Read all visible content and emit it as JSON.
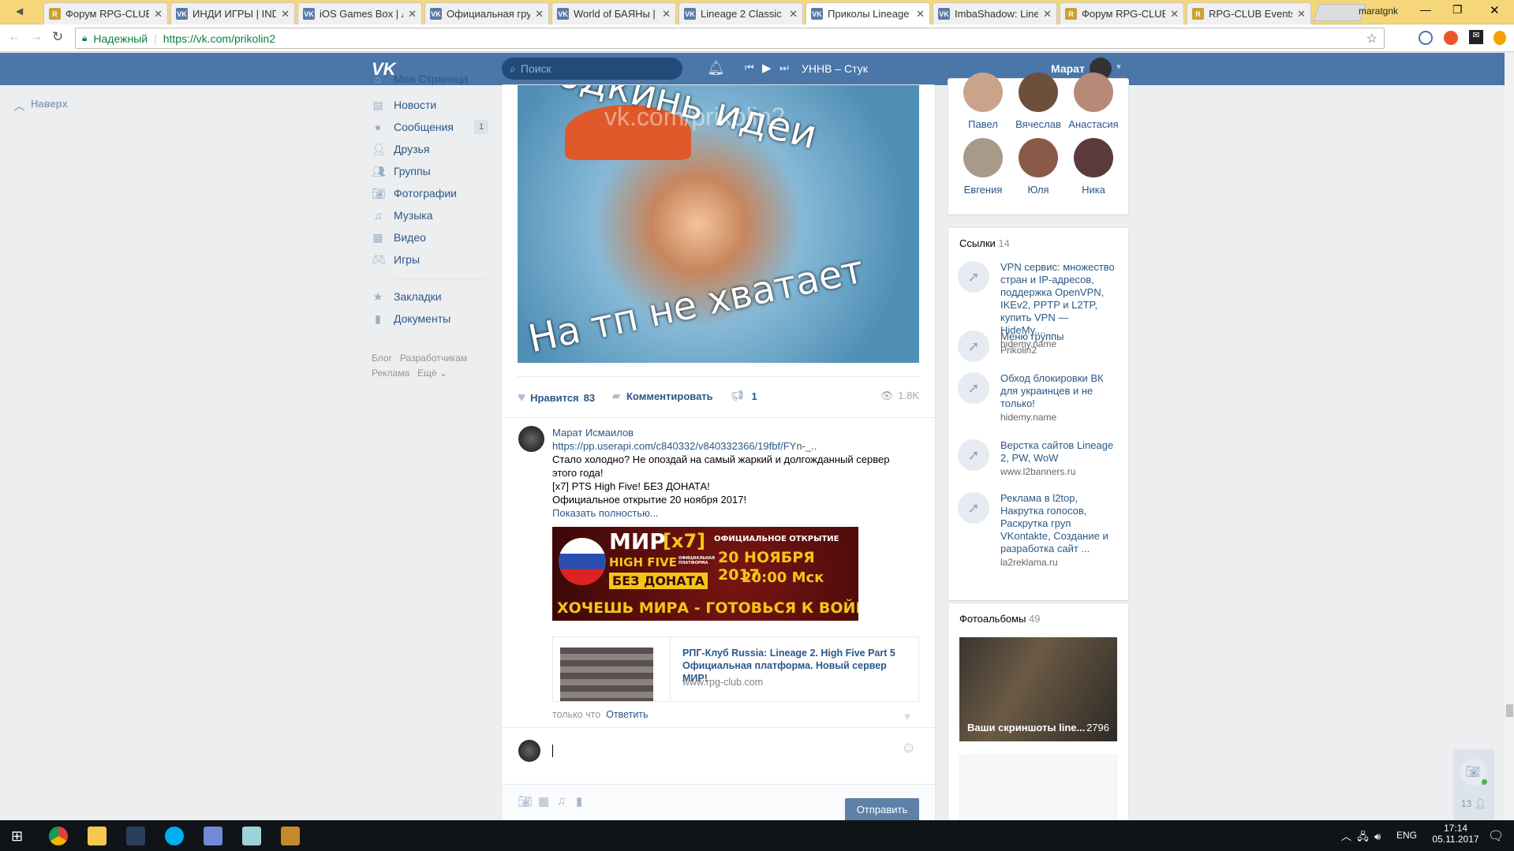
{
  "browser": {
    "tabs": [
      {
        "title": "Форум RPG-CLUB",
        "icon": "rpg"
      },
      {
        "title": "ИНДИ ИГРЫ | IND",
        "icon": "vk"
      },
      {
        "title": "iOS Games Box | Л",
        "icon": "vk"
      },
      {
        "title": "Официальная гру",
        "icon": "vk"
      },
      {
        "title": "World of БАЯНы |",
        "icon": "vk"
      },
      {
        "title": "Lineage 2 Classic",
        "icon": "vk"
      },
      {
        "title": "Приколы Lineage",
        "icon": "vk",
        "active": true
      },
      {
        "title": "ImbaShadow: Line",
        "icon": "vk"
      },
      {
        "title": "Форум RPG-CLUB",
        "icon": "rpg"
      },
      {
        "title": "RPG-CLUB Events",
        "icon": "rpg"
      }
    ],
    "profile_name": "maratgnk",
    "secure_label": "Надежный",
    "url": "https://vk.com/prikolin2"
  },
  "header": {
    "search_placeholder": "Поиск",
    "track": "УННВ – Стук",
    "user": "Марат"
  },
  "scroll_top": "Наверх",
  "menu": [
    {
      "label": "Моя Страница",
      "icon": "home"
    },
    {
      "label": "Новости",
      "icon": "news"
    },
    {
      "label": "Сообщения",
      "icon": "messages",
      "badge": "1"
    },
    {
      "label": "Друзья",
      "icon": "friends"
    },
    {
      "label": "Группы",
      "icon": "groups"
    },
    {
      "label": "Фотографии",
      "icon": "photos"
    },
    {
      "label": "Музыка",
      "icon": "music"
    },
    {
      "label": "Видео",
      "icon": "video"
    },
    {
      "label": "Игры",
      "icon": "games"
    },
    {
      "label": "Закладки",
      "icon": "bookmarks"
    },
    {
      "label": "Документы",
      "icon": "documents"
    }
  ],
  "footer_links": [
    "Блог",
    "Разработчикам",
    "Реклама",
    "Ещё"
  ],
  "post": {
    "image_text_top": "Подкинь идеи",
    "image_text_bottom": "На тп не хватает",
    "watermark": "vk.com/prikolin2",
    "like_label": "Нравится",
    "likes": "83",
    "comment_label": "Комментировать",
    "shares": "1",
    "views": "1.8K"
  },
  "comment": {
    "author": "Марат Исмаилов",
    "url": "https://pp.userapi.com/c840332/v840332366/19fbf/FYn-_..",
    "lines": [
      "Стало холодно? Не опоздай на самый жаркий и долгожданный сервер этого года!",
      "[x7] PTS High Five! БЕЗ ДОНАТА!",
      "Официальное открытие 20 ноября 2017!"
    ],
    "show_more": "Показать полностью...",
    "banner": {
      "title": "МИР",
      "rate": "[x7]",
      "sub": "HIGH FIVE",
      "platform": "ОФИЦИАЛЬНАЯ ПЛАТФОРМА",
      "nodonate": "БЕЗ ДОНАТА",
      "opening": "ОФИЦИАЛЬНОЕ ОТКРЫТИЕ",
      "date": "20 НОЯБРЯ 2017",
      "time": "20:00 Мск",
      "slogan": "ХОЧЕШЬ МИРА - ГОТОВЬСЯ К ВОЙНЕ"
    },
    "card_title": "РПГ-Клуб Russia: Lineage 2. High Five Part 5 Официальная платформа. Новый сервер МИР!",
    "card_domain": "www.rpg-club.com",
    "time": "только что",
    "reply": "Ответить"
  },
  "reply_box": {
    "send": "Отправить"
  },
  "friends": [
    "Павел",
    "Вячеслав",
    "Анастасия",
    "Евгения",
    "Юля",
    "Ника"
  ],
  "links": {
    "title": "Ссылки",
    "count": "14",
    "items": [
      {
        "title": "VPN сервис: множество стран и IP-адресов, поддержка OpenVPN, IKEv2, PPTP и L2TP, купить VPN — HideMy....",
        "domain": "hidemy.name"
      },
      {
        "title": "Меню группы",
        "domain": "Prikolin2"
      },
      {
        "title": "Обход блокировки ВК для украинцев и не только!",
        "domain": "hidemy.name"
      },
      {
        "title": "Верстка сайтов Lineage 2, PW, WoW",
        "domain": "www.l2banners.ru"
      },
      {
        "title": "Реклама в l2top, Накрутка голосов, Раскрутка груп VKontakte, Создание и разработка сайт ...",
        "domain": "la2reklama.ru"
      }
    ]
  },
  "albums": {
    "title": "Фотоальбомы",
    "count": "49",
    "first_name": "Ваши скриншоты line...",
    "first_count": "2796"
  },
  "chat_widget": {
    "online": "13"
  },
  "taskbar": {
    "lang": "ENG",
    "time": "17:14",
    "date": "05.11.2017"
  }
}
